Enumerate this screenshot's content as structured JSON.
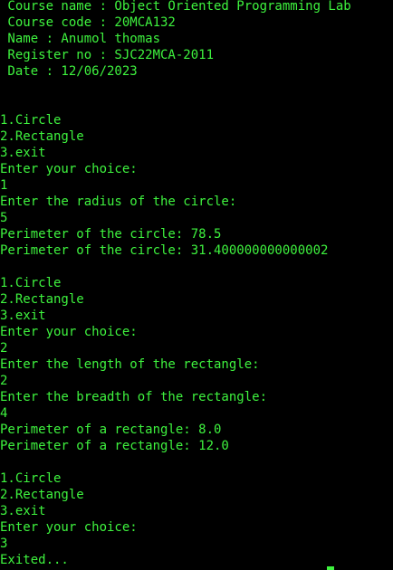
{
  "terminal": {
    "text_color": "#3ef23e",
    "background_color": "#000000",
    "lines": [
      " Course name : Object Oriented Programming Lab",
      " Course code : 20MCA132",
      " Name : Anumol thomas",
      " Register no : SJC22MCA-2011",
      " Date : 12/06/2023",
      "",
      "",
      "1.Circle",
      "2.Rectangle",
      "3.exit",
      "Enter your choice:",
      "1",
      "Enter the radius of the circle:",
      "5",
      "Perimeter of the circle: 78.5",
      "Perimeter of the circle: 31.400000000000002",
      "",
      "1.Circle",
      "2.Rectangle",
      "3.exit",
      "Enter your choice:",
      "2",
      "Enter the length of the rectangle:",
      "2",
      "Enter the breadth of the rectangle:",
      "4",
      "Perimeter of a rectangle: 8.0",
      "Perimeter of a rectangle: 12.0",
      "",
      "1.Circle",
      "2.Rectangle",
      "3.exit",
      "Enter your choice:",
      "3",
      "Exited..."
    ]
  }
}
